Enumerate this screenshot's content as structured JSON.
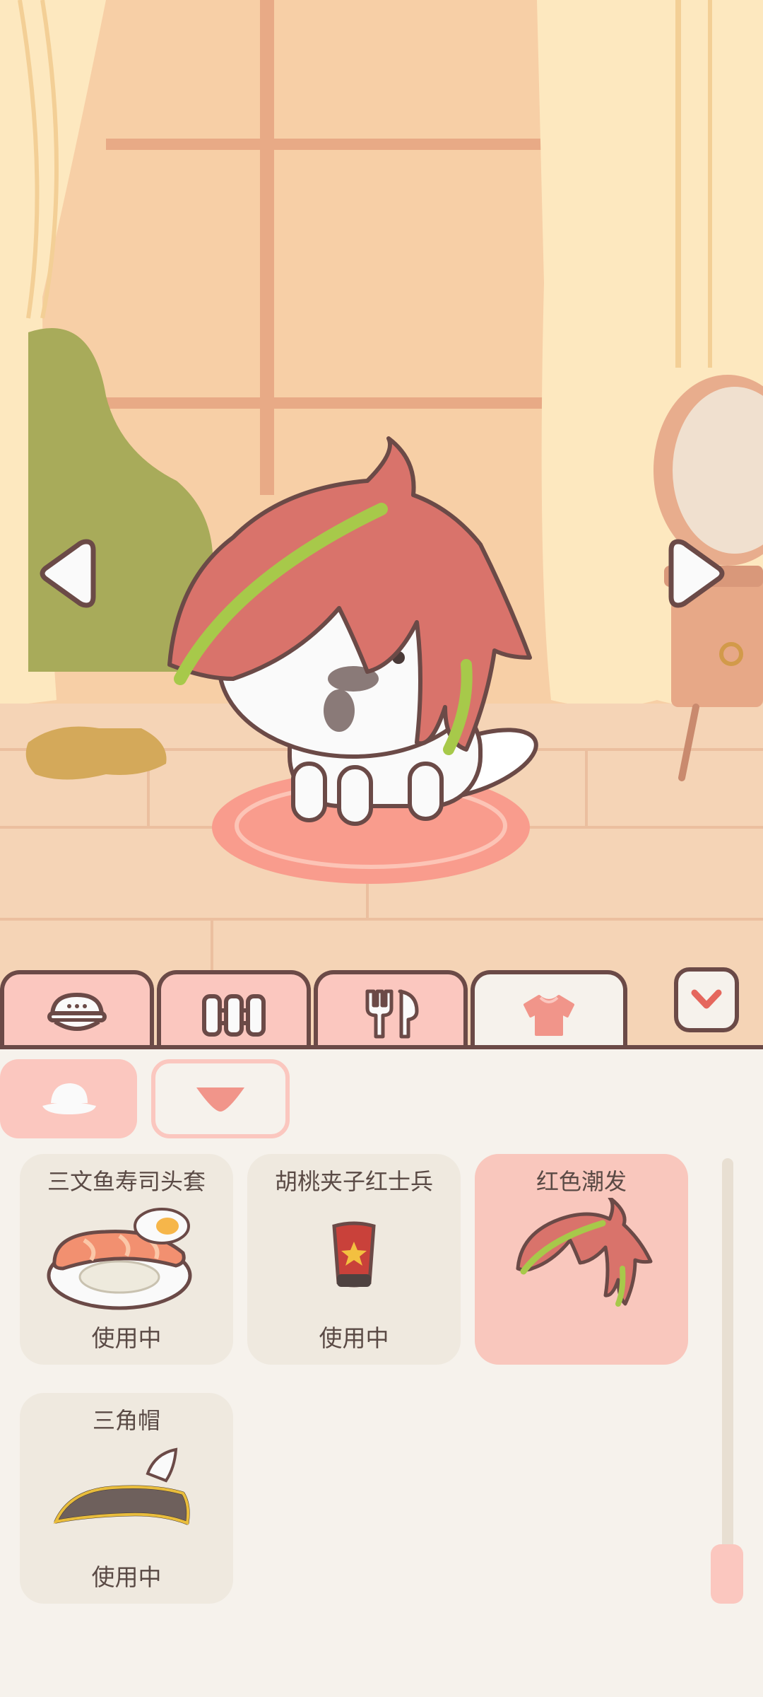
{
  "tabs": [
    {
      "icon": "food-bowl-icon"
    },
    {
      "icon": "fence-icon"
    },
    {
      "icon": "cutlery-icon"
    },
    {
      "icon": "shirt-icon",
      "active": true
    }
  ],
  "subtabs": [
    {
      "icon": "hat-icon",
      "active": true
    },
    {
      "icon": "triangle-down-icon"
    }
  ],
  "items": [
    {
      "name": "三文鱼寿司头套",
      "status": "使用中",
      "icon": "salmon-sushi-hat-icon"
    },
    {
      "name": "胡桃夹子红士兵",
      "status": "使用中",
      "icon": "nutcracker-hat-icon"
    },
    {
      "name": "红色潮发",
      "status": "",
      "icon": "red-hair-icon",
      "selected": true
    },
    {
      "name": "三角帽",
      "status": "使用中",
      "icon": "tricorn-hat-icon"
    }
  ],
  "colors": {
    "accent_pink": "#fbc7bf",
    "outline_brown": "#6b4a47",
    "panel_bg": "#f6f2ec",
    "card_bg": "#efe9df",
    "selected_card": "#f9c7bd",
    "hair_red": "#d9736b",
    "hair_green": "#a7c94a"
  }
}
